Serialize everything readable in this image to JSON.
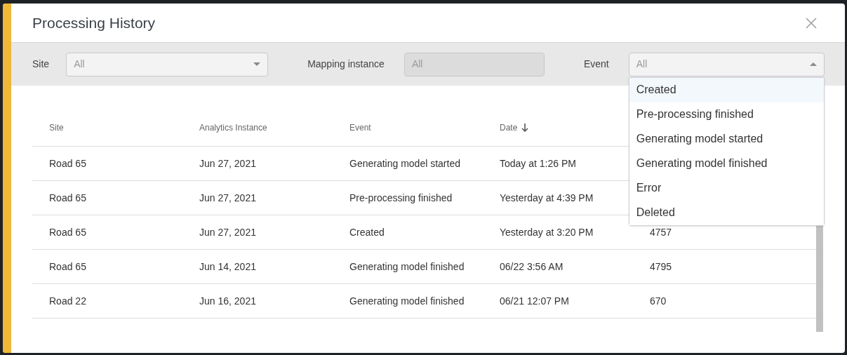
{
  "dialog": {
    "title": "Processing History"
  },
  "filters": [
    {
      "kind": "select",
      "label": "Site",
      "value": "All",
      "disabled": false,
      "open": false
    },
    {
      "kind": "select",
      "label": "Mapping instance",
      "value": "All",
      "disabled": true,
      "open": false
    },
    {
      "kind": "select",
      "label": "Event",
      "value": "All",
      "disabled": false,
      "open": true,
      "options": [
        {
          "label": "Created",
          "highlighted": true
        },
        {
          "label": "Pre-processing finished",
          "highlighted": false
        },
        {
          "label": "Generating model started",
          "highlighted": false
        },
        {
          "label": "Generating model finished",
          "highlighted": false
        },
        {
          "label": "Error",
          "highlighted": false
        },
        {
          "label": "Deleted",
          "highlighted": false
        }
      ]
    }
  ],
  "table": {
    "columns": [
      {
        "label": "Site",
        "sorted": false
      },
      {
        "label": "Analytics Instance",
        "sorted": false
      },
      {
        "label": "Event",
        "sorted": false
      },
      {
        "label": "Date",
        "sorted": true
      }
    ],
    "rows": [
      {
        "cells": [
          "Road 65",
          "Jun 27, 2021",
          "Generating model started",
          "Today at 1:26 PM"
        ]
      },
      {
        "cells": [
          "Road 65",
          "Jun 27, 2021",
          "Pre-processing finished",
          "Yesterday at 4:39 PM"
        ]
      },
      {
        "cells": [
          "Road 65",
          "Jun 27, 2021",
          "Created",
          "Yesterday at 3:20 PM",
          "4757"
        ]
      },
      {
        "cells": [
          "Road 65",
          "Jun 14, 2021",
          "Generating model finished",
          "06/22 3:56 AM",
          "4795"
        ]
      },
      {
        "cells": [
          "Road 22",
          "Jun 16, 2021",
          "Generating model finished",
          "06/21 12:07 PM",
          "670"
        ]
      }
    ]
  }
}
